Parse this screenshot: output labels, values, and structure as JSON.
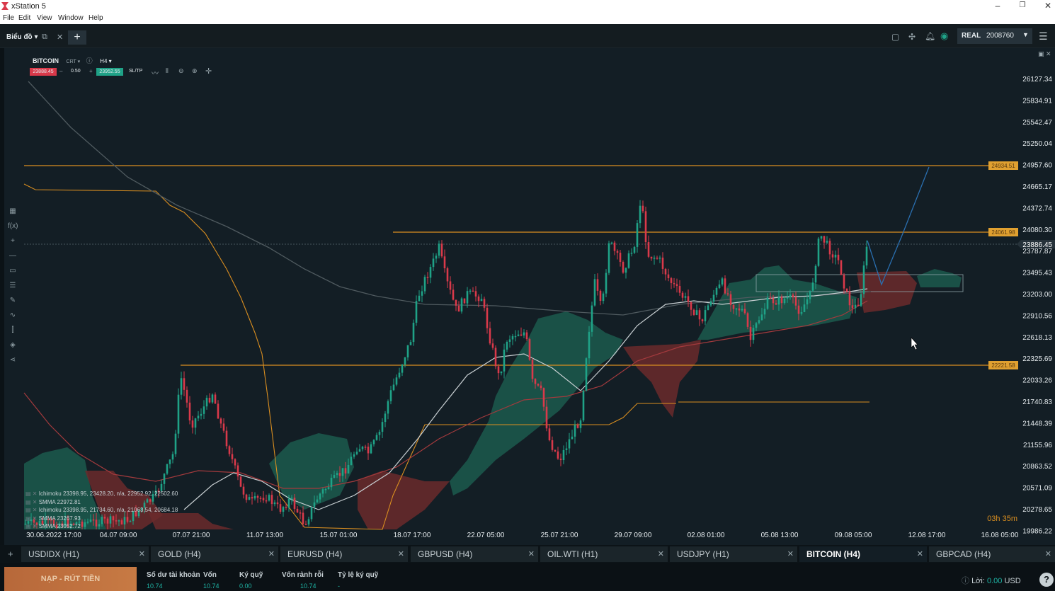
{
  "app": {
    "title": "xStation 5",
    "menu": [
      "File",
      "Edit",
      "View",
      "Window",
      "Help"
    ]
  },
  "toolbar": {
    "workspace": "Biểu đồ",
    "account_type": "REAL",
    "account_number": "2008760"
  },
  "chart": {
    "symbol": "BITCOIN",
    "chart_type": "CRT",
    "timeframe": "H4",
    "sell_price": "23888.45",
    "volume": "0.50",
    "buy_price": "23952.55",
    "sltp_label": "SL/TP",
    "current_price_tag": "23886.45",
    "countdown": "03h 35m",
    "price_axis": [
      "26127.34",
      "25834.91",
      "25542.47",
      "25250.04",
      "24957.60",
      "24665.17",
      "24372.74",
      "24080.30",
      "23787.87",
      "23495.43",
      "23203.00",
      "22910.56",
      "22618.13",
      "22325.69",
      "22033.26",
      "21740.83",
      "21448.39",
      "21155.96",
      "20863.52",
      "20571.09",
      "20278.65",
      "19986.22"
    ],
    "time_axis": [
      "30.06.2022 17:00",
      "04.07 09:00",
      "07.07 21:00",
      "11.07 13:00",
      "15.07 01:00",
      "18.07 17:00",
      "22.07 05:00",
      "25.07 21:00",
      "29.07 09:00",
      "02.08 01:00",
      "05.08 13:00",
      "09.08 05:00",
      "12.08 17:00",
      "16.08 05:00"
    ],
    "level_tags": [
      "24934.51",
      "24061.98",
      "22221.58"
    ],
    "indicators": [
      "Ichimoku 23398.95, 23428.20, n/a, 22952.92, 22502.60",
      "SMMA 22972.81",
      "Ichimoku 23398.95, 21734.60, n/a, 21063.54, 20684.18",
      "SMMA 23267.93",
      "SMMA 23052.72"
    ]
  },
  "colors": {
    "bg": "#131e25",
    "bull": "#1fa287",
    "bear": "#d9394a",
    "level": "#d98e20",
    "forecast": "#2a6fb0"
  },
  "tabs": [
    {
      "label": "USDIDX (H1)",
      "active": false
    },
    {
      "label": "GOLD (H4)",
      "active": false
    },
    {
      "label": "EURUSD (H4)",
      "active": false
    },
    {
      "label": "GBPUSD (H4)",
      "active": false
    },
    {
      "label": "OIL.WTI (H1)",
      "active": false
    },
    {
      "label": "USDJPY (H1)",
      "active": false
    },
    {
      "label": "BITCOIN (H4)",
      "active": true
    },
    {
      "label": "GBPCAD (H4)",
      "active": false
    }
  ],
  "bottom": {
    "deposit_label": "NẠP - RÚT TIỀN",
    "stats": [
      {
        "label": "Số dư tài khoản",
        "value": "10.74"
      },
      {
        "label": "Vốn",
        "value": "10.74"
      },
      {
        "label": "Ký quỹ",
        "value": "0.00"
      },
      {
        "label": "Vốn rảnh rỗi",
        "value": "10.74"
      },
      {
        "label": "Tỷ lệ ký quỹ",
        "value": "-"
      }
    ],
    "profit_label": "Lời:",
    "profit_value": "0.00",
    "currency": "USD"
  }
}
